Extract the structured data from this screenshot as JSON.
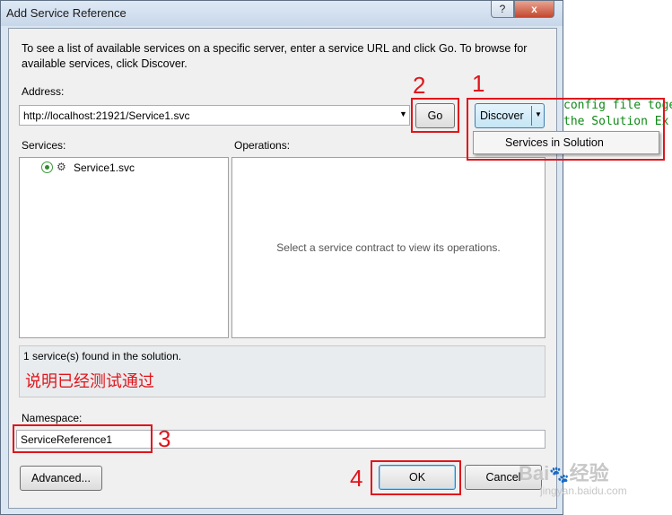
{
  "window": {
    "title": "Add Service Reference",
    "help_glyph": "?",
    "close_glyph": "x"
  },
  "background_code": [
    "config file toge",
    "the Solution Ex"
  ],
  "intro_text": "To see a list of available services on a specific server, enter a service URL and click Go. To browse for available services, click Discover.",
  "address": {
    "label": "Address:",
    "value": "http://localhost:21921/Service1.svc"
  },
  "buttons": {
    "go": "Go",
    "discover": "Discover",
    "advanced": "Advanced...",
    "ok": "OK",
    "cancel": "Cancel"
  },
  "discover_menu": {
    "items": [
      "Services in Solution"
    ]
  },
  "services": {
    "label": "Services:",
    "items": [
      "Service1.svc"
    ]
  },
  "operations": {
    "label": "Operations:",
    "placeholder": "Select a service contract to view its operations."
  },
  "status": {
    "message": "1 service(s) found in the solution.",
    "annotation": "说明已经测试通过"
  },
  "namespace": {
    "label": "Namespace:",
    "value": "ServiceReference1"
  },
  "step_markers": [
    "1",
    "2",
    "3",
    "4"
  ],
  "watermark": {
    "brand": "Bai",
    "brand2": "经验",
    "url": "jingyan.baidu.com"
  },
  "colors": {
    "annotation_red": "#e0151b",
    "code_green": "#0e8a16"
  }
}
